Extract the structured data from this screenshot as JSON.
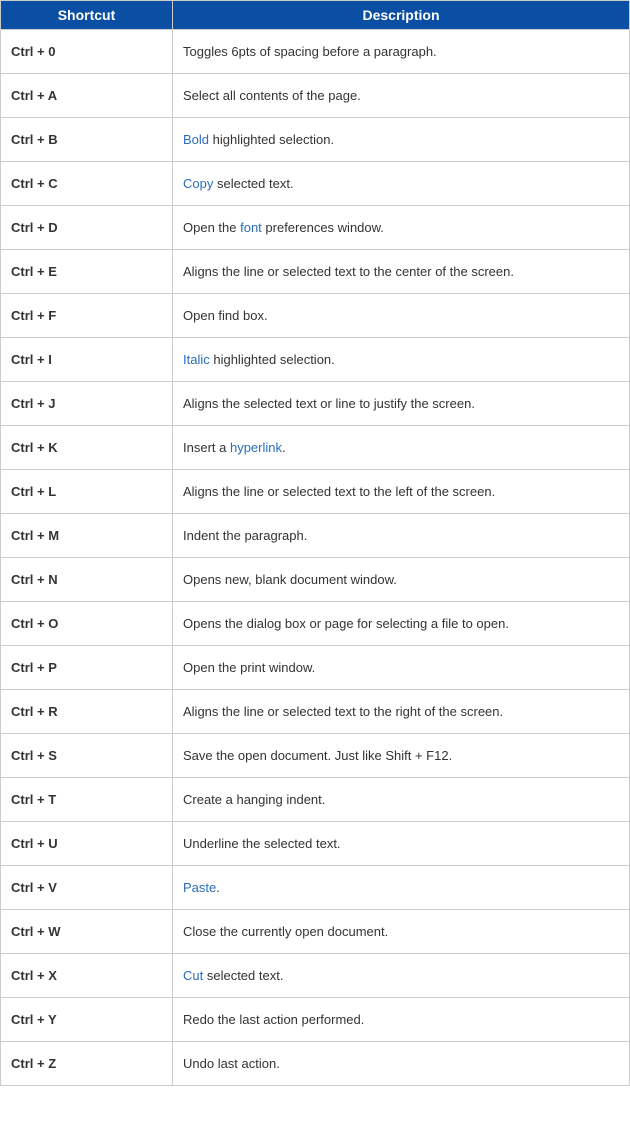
{
  "headers": {
    "shortcut": "Shortcut",
    "description": "Description"
  },
  "rows": [
    {
      "shortcut": "Ctrl + 0",
      "desc_parts": [
        {
          "text": "Toggles 6pts of spacing before a paragraph.",
          "link": false
        }
      ]
    },
    {
      "shortcut": "Ctrl + A",
      "desc_parts": [
        {
          "text": "Select all contents of the page.",
          "link": false
        }
      ]
    },
    {
      "shortcut": "Ctrl + B",
      "desc_parts": [
        {
          "text": "Bold",
          "link": true
        },
        {
          "text": " highlighted selection.",
          "link": false
        }
      ]
    },
    {
      "shortcut": "Ctrl + C",
      "desc_parts": [
        {
          "text": "Copy",
          "link": true
        },
        {
          "text": " selected text.",
          "link": false
        }
      ]
    },
    {
      "shortcut": "Ctrl + D",
      "desc_parts": [
        {
          "text": "Open the ",
          "link": false
        },
        {
          "text": "font",
          "link": true
        },
        {
          "text": " preferences window.",
          "link": false
        }
      ]
    },
    {
      "shortcut": "Ctrl + E",
      "desc_parts": [
        {
          "text": "Aligns the line or selected text to the center of the screen.",
          "link": false
        }
      ]
    },
    {
      "shortcut": "Ctrl + F",
      "desc_parts": [
        {
          "text": "Open find box.",
          "link": false
        }
      ]
    },
    {
      "shortcut": "Ctrl + I",
      "desc_parts": [
        {
          "text": "Italic",
          "link": true
        },
        {
          "text": " highlighted selection.",
          "link": false
        }
      ]
    },
    {
      "shortcut": "Ctrl + J",
      "desc_parts": [
        {
          "text": "Aligns the selected text or line to justify the screen.",
          "link": false
        }
      ]
    },
    {
      "shortcut": "Ctrl + K",
      "desc_parts": [
        {
          "text": "Insert a ",
          "link": false
        },
        {
          "text": "hyperlink",
          "link": true
        },
        {
          "text": ".",
          "link": false
        }
      ]
    },
    {
      "shortcut": "Ctrl + L",
      "desc_parts": [
        {
          "text": "Aligns the line or selected text to the left of the screen.",
          "link": false
        }
      ]
    },
    {
      "shortcut": "Ctrl + M",
      "desc_parts": [
        {
          "text": "Indent the paragraph.",
          "link": false
        }
      ]
    },
    {
      "shortcut": "Ctrl + N",
      "desc_parts": [
        {
          "text": "Opens new, blank document window.",
          "link": false
        }
      ]
    },
    {
      "shortcut": "Ctrl + O",
      "desc_parts": [
        {
          "text": "Opens the dialog box or page for selecting a file to open.",
          "link": false
        }
      ]
    },
    {
      "shortcut": "Ctrl + P",
      "desc_parts": [
        {
          "text": "Open the print window.",
          "link": false
        }
      ]
    },
    {
      "shortcut": "Ctrl + R",
      "desc_parts": [
        {
          "text": "Aligns the line or selected text to the right of the screen.",
          "link": false
        }
      ]
    },
    {
      "shortcut": "Ctrl + S",
      "desc_parts": [
        {
          "text": "Save the open document. Just like Shift + F12.",
          "link": false
        }
      ]
    },
    {
      "shortcut": "Ctrl + T",
      "desc_parts": [
        {
          "text": "Create a hanging indent.",
          "link": false
        }
      ]
    },
    {
      "shortcut": "Ctrl + U",
      "desc_parts": [
        {
          "text": "Underline the selected text.",
          "link": false
        }
      ]
    },
    {
      "shortcut": "Ctrl + V",
      "desc_parts": [
        {
          "text": "Paste",
          "link": true
        },
        {
          "text": ".",
          "link": false
        }
      ]
    },
    {
      "shortcut": "Ctrl + W",
      "desc_parts": [
        {
          "text": "Close the currently open document.",
          "link": false
        }
      ]
    },
    {
      "shortcut": "Ctrl + X",
      "desc_parts": [
        {
          "text": "Cut",
          "link": true
        },
        {
          "text": " selected text.",
          "link": false
        }
      ]
    },
    {
      "shortcut": "Ctrl + Y",
      "desc_parts": [
        {
          "text": "Redo the last action performed.",
          "link": false
        }
      ]
    },
    {
      "shortcut": "Ctrl + Z",
      "desc_parts": [
        {
          "text": "Undo last action.",
          "link": false
        }
      ]
    }
  ]
}
